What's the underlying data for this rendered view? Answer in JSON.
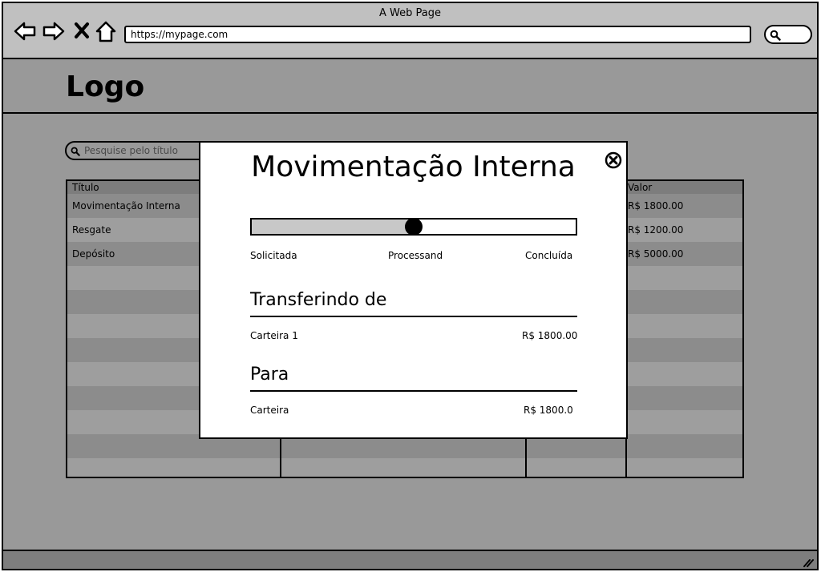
{
  "window": {
    "title": "A Web Page"
  },
  "browser": {
    "url": "https://mypage.com",
    "icons": [
      "back-arrow-icon",
      "forward-arrow-icon",
      "close-x-icon",
      "home-icon",
      "search-icon"
    ]
  },
  "site": {
    "logo": "Logo"
  },
  "search": {
    "placeholder": "Pesquise pelo título"
  },
  "table": {
    "columns": [
      "Título",
      "",
      "",
      "Valor"
    ],
    "rows": [
      {
        "titulo": "Movimentação Interna",
        "valor": "R$ 1800.00"
      },
      {
        "titulo": "Resgate",
        "valor": "R$ 1200.00"
      },
      {
        "titulo": "Depósito",
        "valor": "R$ 5000.00"
      }
    ]
  },
  "modal": {
    "title": "Movimentação Interna",
    "progress": {
      "value": 0.5,
      "steps": [
        "Solicitada",
        "Processand",
        "Concluída"
      ]
    },
    "from": {
      "heading": "Transferindo de",
      "account": "Carteira 1",
      "amount": "R$ 1800.00"
    },
    "to": {
      "heading": "Para",
      "account": "Carteira",
      "amount": "R$ 1800.0"
    }
  },
  "colors": {
    "background": "#999999",
    "chrome": "#c0c0c0",
    "modal": "#ffffff",
    "ink": "#000000"
  }
}
